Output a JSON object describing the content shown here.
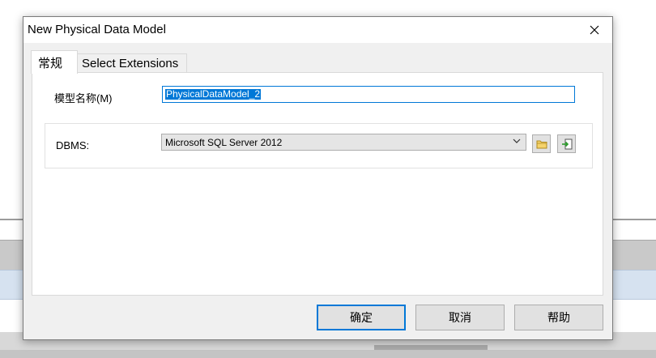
{
  "dialog": {
    "title": "New Physical Data Model",
    "close_icon": "close-icon"
  },
  "tabs": [
    {
      "label": "常规",
      "active": true
    },
    {
      "label": "Select Extensions",
      "active": false
    }
  ],
  "form": {
    "model_name_label": "模型名称(M)",
    "model_name_value": "PhysicalDataModel_2",
    "dbms_label": "DBMS:",
    "dbms_value": "Microsoft SQL Server 2012",
    "folder_icon": "folder-icon",
    "import_icon": "import-icon"
  },
  "buttons": {
    "ok": "确定",
    "cancel": "取消",
    "help": "帮助"
  },
  "colors": {
    "accent": "#0078d7",
    "dialog_bg": "#f0f0f0"
  }
}
